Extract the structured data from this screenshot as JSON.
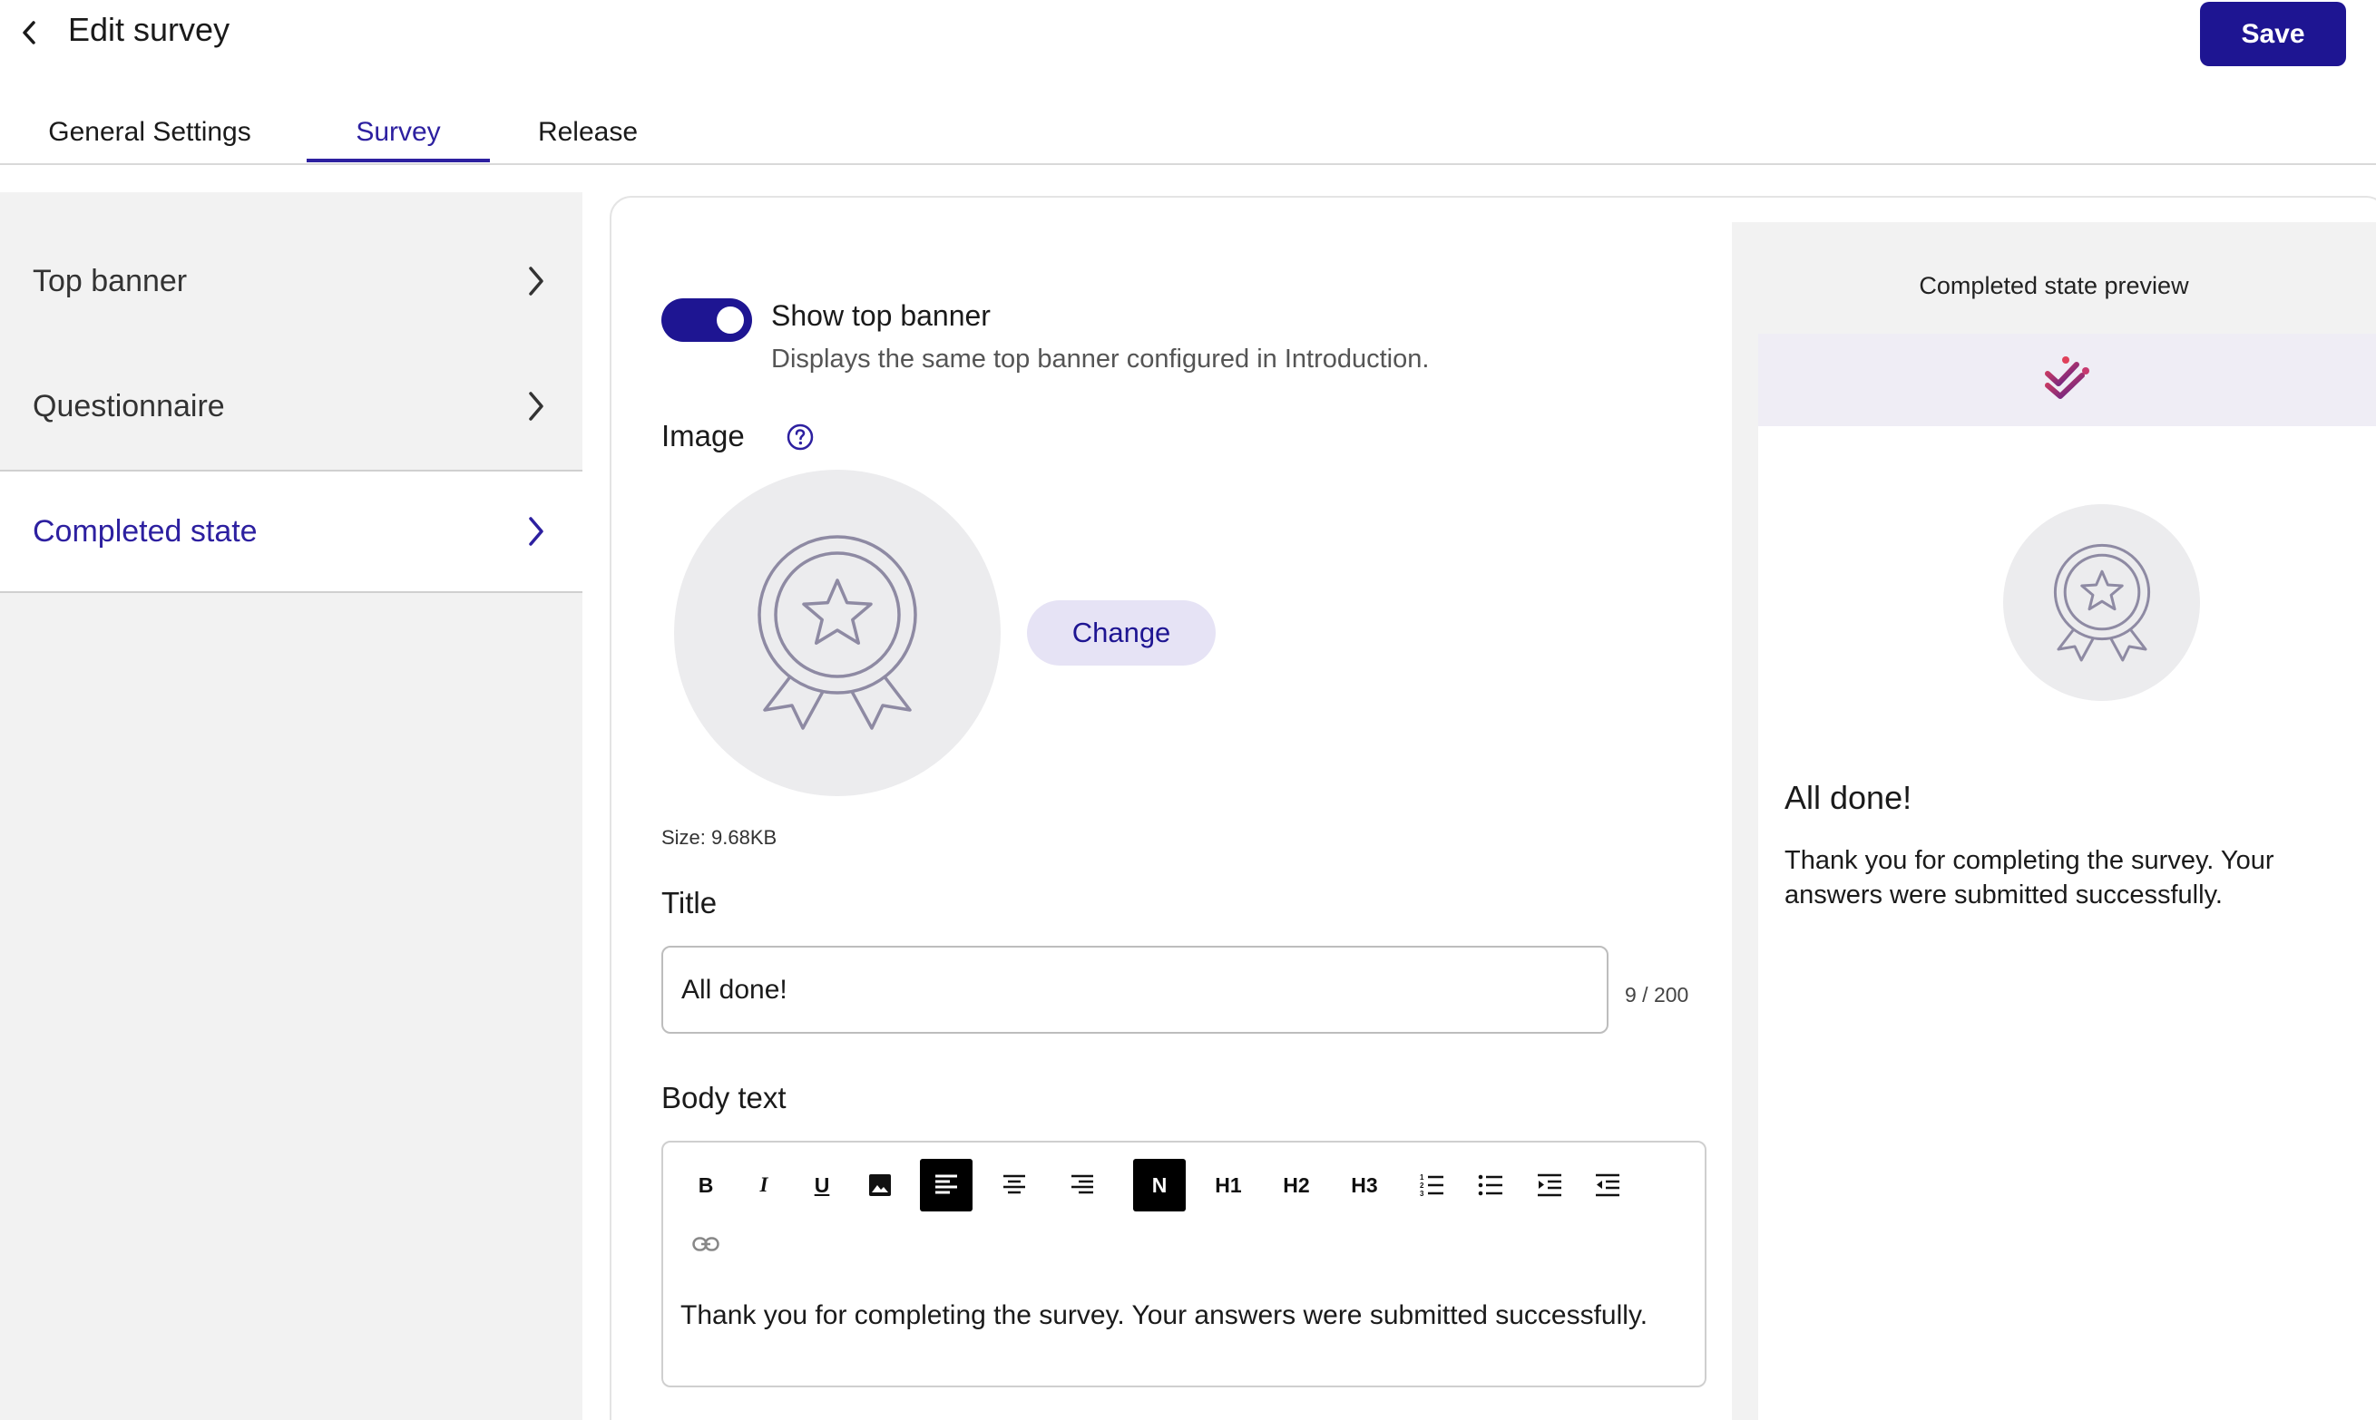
{
  "header": {
    "title": "Edit survey",
    "back_icon": "chevron-left-icon",
    "save_label": "Save"
  },
  "tabs": [
    {
      "label": "General Settings",
      "active": false
    },
    {
      "label": "Survey",
      "active": true
    },
    {
      "label": "Release",
      "active": false
    }
  ],
  "sidebar": {
    "items": [
      {
        "label": "Top banner",
        "active": false
      },
      {
        "label": "Questionnaire",
        "active": false
      },
      {
        "label": "Completed state",
        "active": true
      }
    ]
  },
  "form": {
    "show_banner": {
      "label": "Show top banner",
      "description": "Displays the same top banner configured in Introduction.",
      "on": true
    },
    "image": {
      "label": "Image",
      "help_icon": "question-circle-icon",
      "change_label": "Change",
      "size_text": "Size: 9.68KB",
      "placeholder_icon": "award-medal-icon"
    },
    "title": {
      "label": "Title",
      "value": "All done!",
      "count": "9 / 200"
    },
    "body": {
      "label": "Body text",
      "toolbar": [
        {
          "name": "bold",
          "text": "B"
        },
        {
          "name": "italic",
          "text": "I"
        },
        {
          "name": "underline",
          "text": "U"
        },
        {
          "name": "image",
          "text": ""
        },
        {
          "name": "align-left",
          "text": ""
        },
        {
          "name": "align-center",
          "text": ""
        },
        {
          "name": "align-right",
          "text": ""
        },
        {
          "name": "normal",
          "text": "N"
        },
        {
          "name": "h1",
          "text": "H1"
        },
        {
          "name": "h2",
          "text": "H2"
        },
        {
          "name": "h3",
          "text": "H3"
        },
        {
          "name": "ordered-list",
          "text": ""
        },
        {
          "name": "bullet-list",
          "text": ""
        },
        {
          "name": "indent",
          "text": ""
        },
        {
          "name": "outdent",
          "text": ""
        },
        {
          "name": "link",
          "text": ""
        }
      ],
      "text": "Thank you for completing the survey. Your answers were submitted successfully."
    }
  },
  "preview": {
    "label": "Completed state preview",
    "title": "All done!",
    "body": "Thank you for completing the survey. Your answers were submitted successfully."
  },
  "colors": {
    "primary": "#1e1592",
    "accent_text": "#2d20a0",
    "nav_bg": "#f2f2f2",
    "chip_bg": "#e6e3f5"
  }
}
